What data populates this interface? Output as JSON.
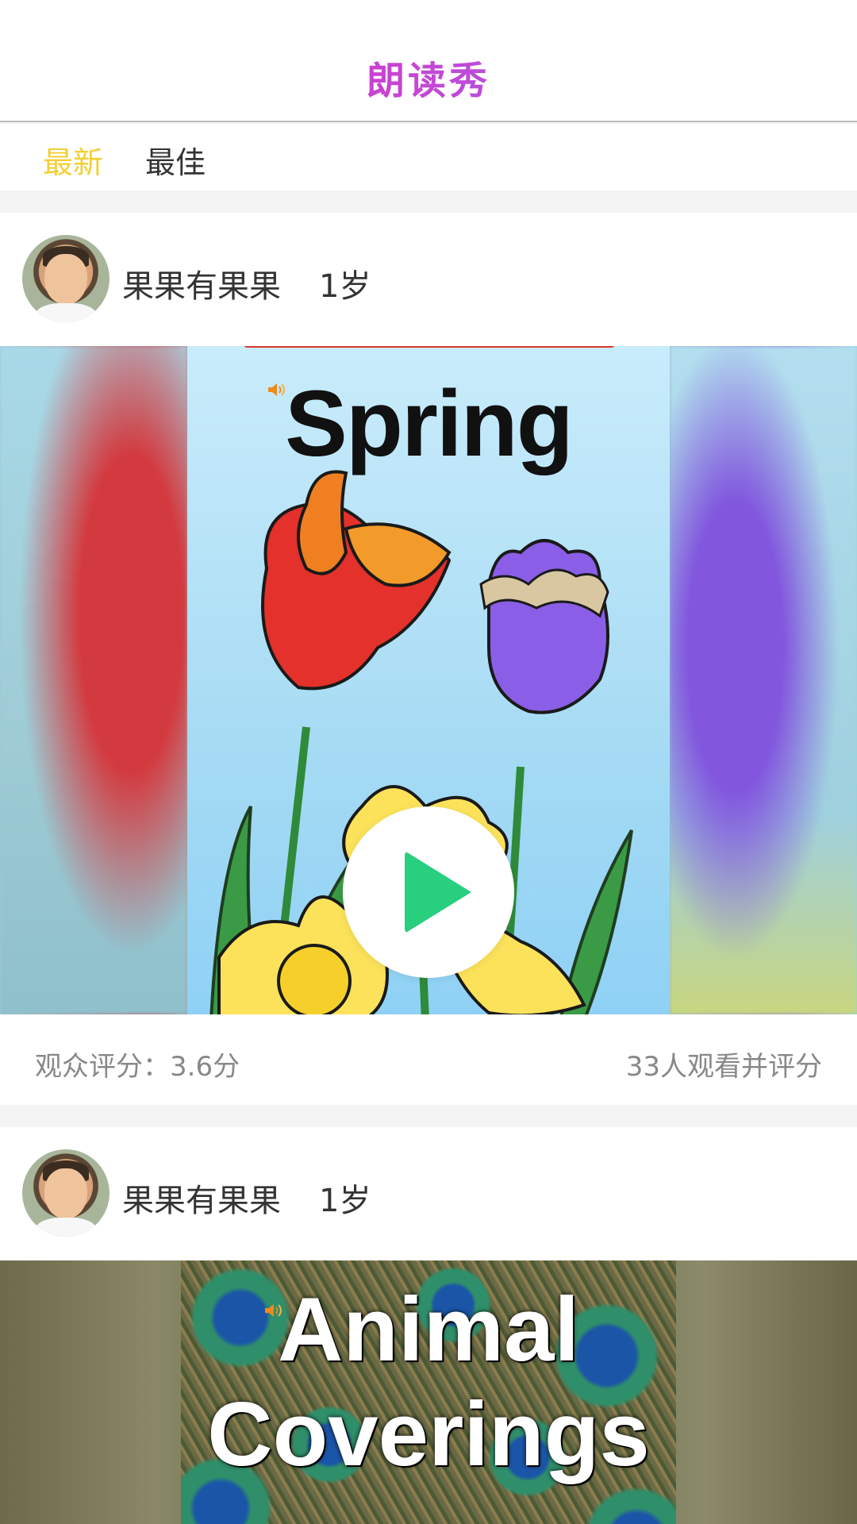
{
  "header": {
    "title": "朗读秀"
  },
  "tabs": [
    {
      "label": "最新",
      "active": true,
      "color": "#f2cf35"
    },
    {
      "label": "最佳",
      "active": false
    }
  ],
  "feed": [
    {
      "user": {
        "name": "果果有果果",
        "age": "1岁"
      },
      "book_title": "Spring",
      "rating": "观众评分：3.6分",
      "viewers": "33人观看并评分",
      "icons": [
        "speaker-icon",
        "play-icon"
      ]
    },
    {
      "user": {
        "name": "果果有果果",
        "age": "1岁"
      },
      "book_title_lines": [
        "Animal",
        "Coverings"
      ],
      "icons": [
        "speaker-icon",
        "play-icon"
      ]
    }
  ],
  "colors": {
    "accent": "#f2cf35",
    "play": "#27cf7e",
    "title_gradient": [
      "#e81ea5",
      "#7a6cf0"
    ]
  }
}
